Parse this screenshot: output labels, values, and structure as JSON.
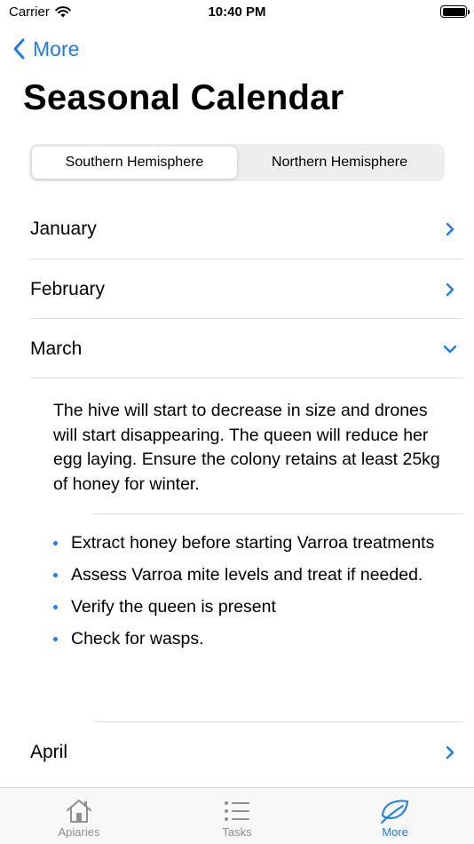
{
  "status_bar": {
    "carrier": "Carrier",
    "time": "10:40 PM"
  },
  "nav": {
    "back_label": "More"
  },
  "page": {
    "title": "Seasonal Calendar"
  },
  "hemisphere_picker": {
    "options": [
      "Southern Hemisphere",
      "Northern Hemisphere"
    ],
    "selected": "Southern Hemisphere"
  },
  "months": [
    {
      "name": "January",
      "expanded": false
    },
    {
      "name": "February",
      "expanded": false
    },
    {
      "name": "March",
      "expanded": true
    },
    {
      "name": "April",
      "expanded": false
    }
  ],
  "march_detail": {
    "description": "The hive will start to decrease in size and drones will start disappearing. The queen will reduce her egg laying. Ensure the colony retains at least 25kg of honey for winter.",
    "tasks": [
      "Extract honey before starting Varroa treatments",
      "Assess Varroa mite levels and treat if needed.",
      "Verify the queen is present",
      "Check for wasps."
    ]
  },
  "tab_bar": {
    "tabs": [
      {
        "label": "Apiaries",
        "icon": "house-icon"
      },
      {
        "label": "Tasks",
        "icon": "list-icon"
      },
      {
        "label": "More",
        "icon": "leaf-icon"
      }
    ],
    "selected": "More"
  },
  "colors": {
    "accent": "#1a7cf5",
    "inactive": "#8e8e93",
    "divider": "#dcdcdf"
  }
}
